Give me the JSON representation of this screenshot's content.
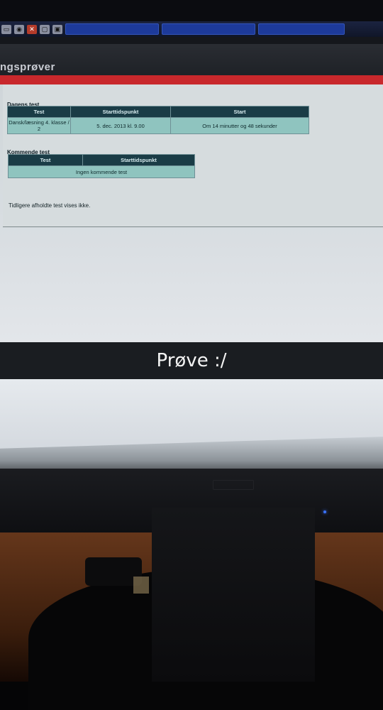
{
  "app": {
    "title": "ngsprøver"
  },
  "todays_test": {
    "heading": "Dagens test",
    "columns": [
      "Test",
      "Starttidspunkt",
      "Start"
    ],
    "row": {
      "test": "Dansk/læsning 4. klasse / 2",
      "start_time": "5. dec. 2013 kl. 9.00",
      "start": "Om 14 minutter og 48 sekunder"
    }
  },
  "upcoming": {
    "heading": "Kommende test",
    "columns": [
      "Test",
      "Starttidspunkt"
    ],
    "empty_text": "Ingen kommende test"
  },
  "note": "Tidligere afholdte test vises ikke.",
  "caption": "Prøve :/",
  "colors": {
    "accent_red": "#c8282c",
    "table_header": "#1a3c46",
    "table_cell": "#8fc4bf"
  }
}
